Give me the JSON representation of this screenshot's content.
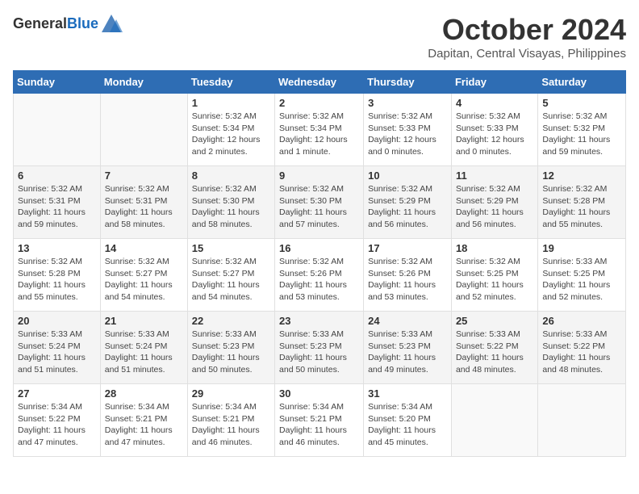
{
  "header": {
    "logo_general": "General",
    "logo_blue": "Blue",
    "month": "October 2024",
    "location": "Dapitan, Central Visayas, Philippines"
  },
  "days_of_week": [
    "Sunday",
    "Monday",
    "Tuesday",
    "Wednesday",
    "Thursday",
    "Friday",
    "Saturday"
  ],
  "weeks": [
    [
      {
        "day": "",
        "detail": ""
      },
      {
        "day": "",
        "detail": ""
      },
      {
        "day": "1",
        "detail": "Sunrise: 5:32 AM\nSunset: 5:34 PM\nDaylight: 12 hours and 2 minutes."
      },
      {
        "day": "2",
        "detail": "Sunrise: 5:32 AM\nSunset: 5:34 PM\nDaylight: 12 hours and 1 minute."
      },
      {
        "day": "3",
        "detail": "Sunrise: 5:32 AM\nSunset: 5:33 PM\nDaylight: 12 hours and 0 minutes."
      },
      {
        "day": "4",
        "detail": "Sunrise: 5:32 AM\nSunset: 5:33 PM\nDaylight: 12 hours and 0 minutes."
      },
      {
        "day": "5",
        "detail": "Sunrise: 5:32 AM\nSunset: 5:32 PM\nDaylight: 11 hours and 59 minutes."
      }
    ],
    [
      {
        "day": "6",
        "detail": "Sunrise: 5:32 AM\nSunset: 5:31 PM\nDaylight: 11 hours and 59 minutes."
      },
      {
        "day": "7",
        "detail": "Sunrise: 5:32 AM\nSunset: 5:31 PM\nDaylight: 11 hours and 58 minutes."
      },
      {
        "day": "8",
        "detail": "Sunrise: 5:32 AM\nSunset: 5:30 PM\nDaylight: 11 hours and 58 minutes."
      },
      {
        "day": "9",
        "detail": "Sunrise: 5:32 AM\nSunset: 5:30 PM\nDaylight: 11 hours and 57 minutes."
      },
      {
        "day": "10",
        "detail": "Sunrise: 5:32 AM\nSunset: 5:29 PM\nDaylight: 11 hours and 56 minutes."
      },
      {
        "day": "11",
        "detail": "Sunrise: 5:32 AM\nSunset: 5:29 PM\nDaylight: 11 hours and 56 minutes."
      },
      {
        "day": "12",
        "detail": "Sunrise: 5:32 AM\nSunset: 5:28 PM\nDaylight: 11 hours and 55 minutes."
      }
    ],
    [
      {
        "day": "13",
        "detail": "Sunrise: 5:32 AM\nSunset: 5:28 PM\nDaylight: 11 hours and 55 minutes."
      },
      {
        "day": "14",
        "detail": "Sunrise: 5:32 AM\nSunset: 5:27 PM\nDaylight: 11 hours and 54 minutes."
      },
      {
        "day": "15",
        "detail": "Sunrise: 5:32 AM\nSunset: 5:27 PM\nDaylight: 11 hours and 54 minutes."
      },
      {
        "day": "16",
        "detail": "Sunrise: 5:32 AM\nSunset: 5:26 PM\nDaylight: 11 hours and 53 minutes."
      },
      {
        "day": "17",
        "detail": "Sunrise: 5:32 AM\nSunset: 5:26 PM\nDaylight: 11 hours and 53 minutes."
      },
      {
        "day": "18",
        "detail": "Sunrise: 5:32 AM\nSunset: 5:25 PM\nDaylight: 11 hours and 52 minutes."
      },
      {
        "day": "19",
        "detail": "Sunrise: 5:33 AM\nSunset: 5:25 PM\nDaylight: 11 hours and 52 minutes."
      }
    ],
    [
      {
        "day": "20",
        "detail": "Sunrise: 5:33 AM\nSunset: 5:24 PM\nDaylight: 11 hours and 51 minutes."
      },
      {
        "day": "21",
        "detail": "Sunrise: 5:33 AM\nSunset: 5:24 PM\nDaylight: 11 hours and 51 minutes."
      },
      {
        "day": "22",
        "detail": "Sunrise: 5:33 AM\nSunset: 5:23 PM\nDaylight: 11 hours and 50 minutes."
      },
      {
        "day": "23",
        "detail": "Sunrise: 5:33 AM\nSunset: 5:23 PM\nDaylight: 11 hours and 50 minutes."
      },
      {
        "day": "24",
        "detail": "Sunrise: 5:33 AM\nSunset: 5:23 PM\nDaylight: 11 hours and 49 minutes."
      },
      {
        "day": "25",
        "detail": "Sunrise: 5:33 AM\nSunset: 5:22 PM\nDaylight: 11 hours and 48 minutes."
      },
      {
        "day": "26",
        "detail": "Sunrise: 5:33 AM\nSunset: 5:22 PM\nDaylight: 11 hours and 48 minutes."
      }
    ],
    [
      {
        "day": "27",
        "detail": "Sunrise: 5:34 AM\nSunset: 5:22 PM\nDaylight: 11 hours and 47 minutes."
      },
      {
        "day": "28",
        "detail": "Sunrise: 5:34 AM\nSunset: 5:21 PM\nDaylight: 11 hours and 47 minutes."
      },
      {
        "day": "29",
        "detail": "Sunrise: 5:34 AM\nSunset: 5:21 PM\nDaylight: 11 hours and 46 minutes."
      },
      {
        "day": "30",
        "detail": "Sunrise: 5:34 AM\nSunset: 5:21 PM\nDaylight: 11 hours and 46 minutes."
      },
      {
        "day": "31",
        "detail": "Sunrise: 5:34 AM\nSunset: 5:20 PM\nDaylight: 11 hours and 45 minutes."
      },
      {
        "day": "",
        "detail": ""
      },
      {
        "day": "",
        "detail": ""
      }
    ]
  ]
}
